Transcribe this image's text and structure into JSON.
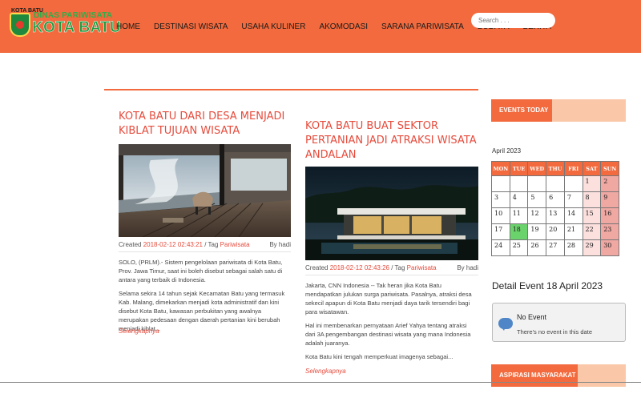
{
  "header": {
    "logo": {
      "small": "KOTA BATU",
      "line1": "DINAS PARIWISATA",
      "line2": "KOTA BATU"
    },
    "nav": [
      "HOME",
      "DESTINASI WISATA",
      "USAHA KULINER",
      "AKOMODASI",
      "SARANA PARIWISATA",
      "BUDAYA",
      "BERITA"
    ],
    "search_placeholder": "Search . . ."
  },
  "posts": [
    {
      "title": "KOTA BATU DARI DESA MENJADI KIBLAT TUJUAN WISATA",
      "created_label": "Created",
      "created": "2018-02-12 02:43:21",
      "tag_label": "/ Tag",
      "tag": "Pariwisata",
      "author": "By hadi",
      "paragraphs": [
        "SOLO, (PRLM).- Sistem pengelolaan pariwisata di Kota Batu, Prov. Jawa Timur, saat ini boleh disebut sebagai salah satu di antara yang terbaik di Indonesia.",
        "Selama sekira 14 tahun sejak Kecamatan Batu yang termasuk Kab. Malang, dimekarkan menjadi kota administratif dan kini disebut Kota Batu, kawasan perbukitan yang awalnya merupakan pedesaan dengan daerah pertanian kini berubah menjadi kiblat..."
      ],
      "more": "Selengkapnya"
    },
    {
      "title": "KOTA BATU BUAT SEKTOR PERTANIAN JADI ATRAKSI WISATA ANDALAN",
      "created_label": "Created",
      "created": "2018-02-12 02:43:26",
      "tag_label": "/ Tag",
      "tag": "Pariwisata",
      "author": "By hadi",
      "paragraphs": [
        "Jakarta, CNN Indonesia -- Tak heran jika Kota Batu mendapatkan julukan surga pariwisata. Pasalnya, atraksi desa sekecil apapun di Kota Batu menjadi daya tarik tersendiri bagi para wisatawan.",
        "Hal ini membenarkan pernyataan Arief Yahya tentang atraksi dari 3A pengembangan destinasi wisata yang mana Indonesia adalah juaranya.",
        "Kota Batu kini tengah memperkuat imagenya sebagai..."
      ],
      "more": "Selengkapnya"
    }
  ],
  "sidebar": {
    "events_title": "EVENTS TODAY",
    "month": "April 2023",
    "weekdays": [
      "MON",
      "TUE",
      "WED",
      "THU",
      "FRI",
      "SAT",
      "SUN"
    ],
    "weeks": [
      [
        "",
        "",
        "",
        "",
        "",
        "1",
        "2"
      ],
      [
        "3",
        "4",
        "5",
        "6",
        "7",
        "8",
        "9"
      ],
      [
        "10",
        "11",
        "12",
        "13",
        "14",
        "15",
        "16"
      ],
      [
        "17",
        "18",
        "19",
        "20",
        "21",
        "22",
        "23"
      ],
      [
        "24",
        "25",
        "26",
        "27",
        "28",
        "29",
        "30"
      ]
    ],
    "today": "18",
    "detail_title": "Detail Event 18 April 2023",
    "no_event": "No Event",
    "no_event_desc": "There's no event in this date",
    "aspirasi_title": "ASPIRASI MASYARAKAT"
  },
  "colors": {
    "primary": "#f26a3d",
    "accent_text": "#e64b3c",
    "saturday": "#fbe0de",
    "sunday": "#f0a8a3",
    "today": "#6bd36b"
  }
}
